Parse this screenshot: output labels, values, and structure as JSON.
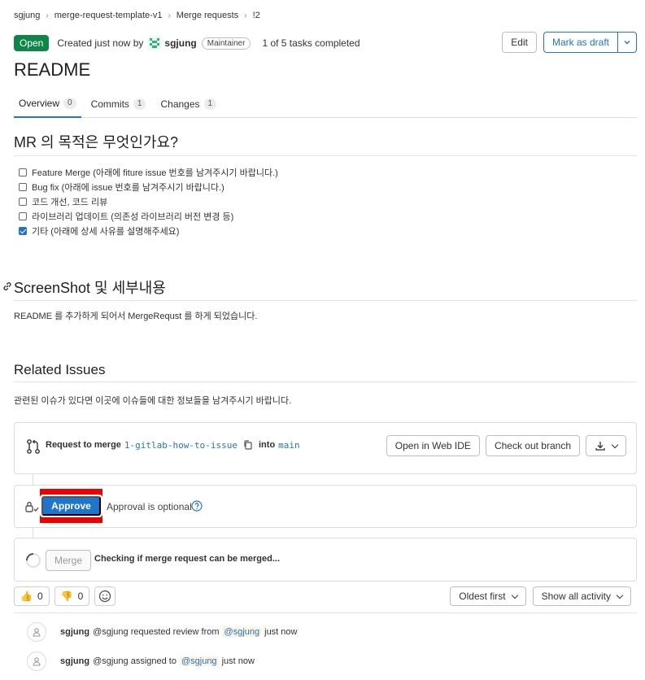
{
  "breadcrumb": [
    "sgjung",
    "merge-request-template-v1",
    "Merge requests",
    "!2"
  ],
  "header": {
    "status": "Open",
    "created_text": "Created just now by",
    "author": "sgjung",
    "role": "Maintainer",
    "tasks": "1 of 5 tasks completed",
    "edit_label": "Edit",
    "draft_label": "Mark as draft"
  },
  "title": "README",
  "tabs": [
    {
      "label": "Overview",
      "count": "0"
    },
    {
      "label": "Commits",
      "count": "1"
    },
    {
      "label": "Changes",
      "count": "1"
    }
  ],
  "description": {
    "purpose_heading": "MR 의 목적은 무엇인가요?",
    "checklist": [
      {
        "label": "Feature Merge (아래에 fiture issue 번호를 남겨주시기 바랍니다.)",
        "checked": false
      },
      {
        "label": "Bug fix (아래에 issue 번호를 남겨주시기 바랍니다.)",
        "checked": false
      },
      {
        "label": "코드 개선, 코드 리뷰",
        "checked": false
      },
      {
        "label": "라이브러리 업데이트 (의존성 라이브러리 버전 변경 등)",
        "checked": false
      },
      {
        "label": "기타 (아래에 상세 사유를 설명해주세요)",
        "checked": true
      }
    ],
    "screenshot_heading": "ScreenShot 및 세부내용",
    "screenshot_text": "README 를 추가하게 되어서 MergeRequst 를 하게 되었습니다.",
    "related_heading": "Related Issues",
    "related_text": "관련된 이슈가 있다면 이곳에 이슈들에 대한 정보들을 남겨주시기 바랍니다."
  },
  "merge_widget": {
    "request_label": "Request to merge",
    "source_branch": "1-gitlab-how-to-issue",
    "into_label": "into",
    "target_branch": "main",
    "web_ide_label": "Open in Web IDE",
    "checkout_label": "Check out branch",
    "approve_label": "Approve",
    "approval_text": "Approval is optional",
    "merge_label": "Merge",
    "checking_text": "Checking if merge request can be merged..."
  },
  "reactions": {
    "thumbs_up": "0",
    "thumbs_down": "0"
  },
  "sort": {
    "order_label": "Oldest first",
    "filter_label": "Show all activity"
  },
  "activity": [
    {
      "author": "sgjung",
      "pre": "@sgjung requested review from",
      "mention": "@sgjung",
      "time": "just now"
    },
    {
      "author": "sgjung",
      "pre": "@sgjung assigned to",
      "mention": "@sgjung",
      "time": "just now"
    }
  ],
  "colors": {
    "accent": "#1f75cb",
    "open_badge": "#108548",
    "highlight": "#ee0000"
  }
}
